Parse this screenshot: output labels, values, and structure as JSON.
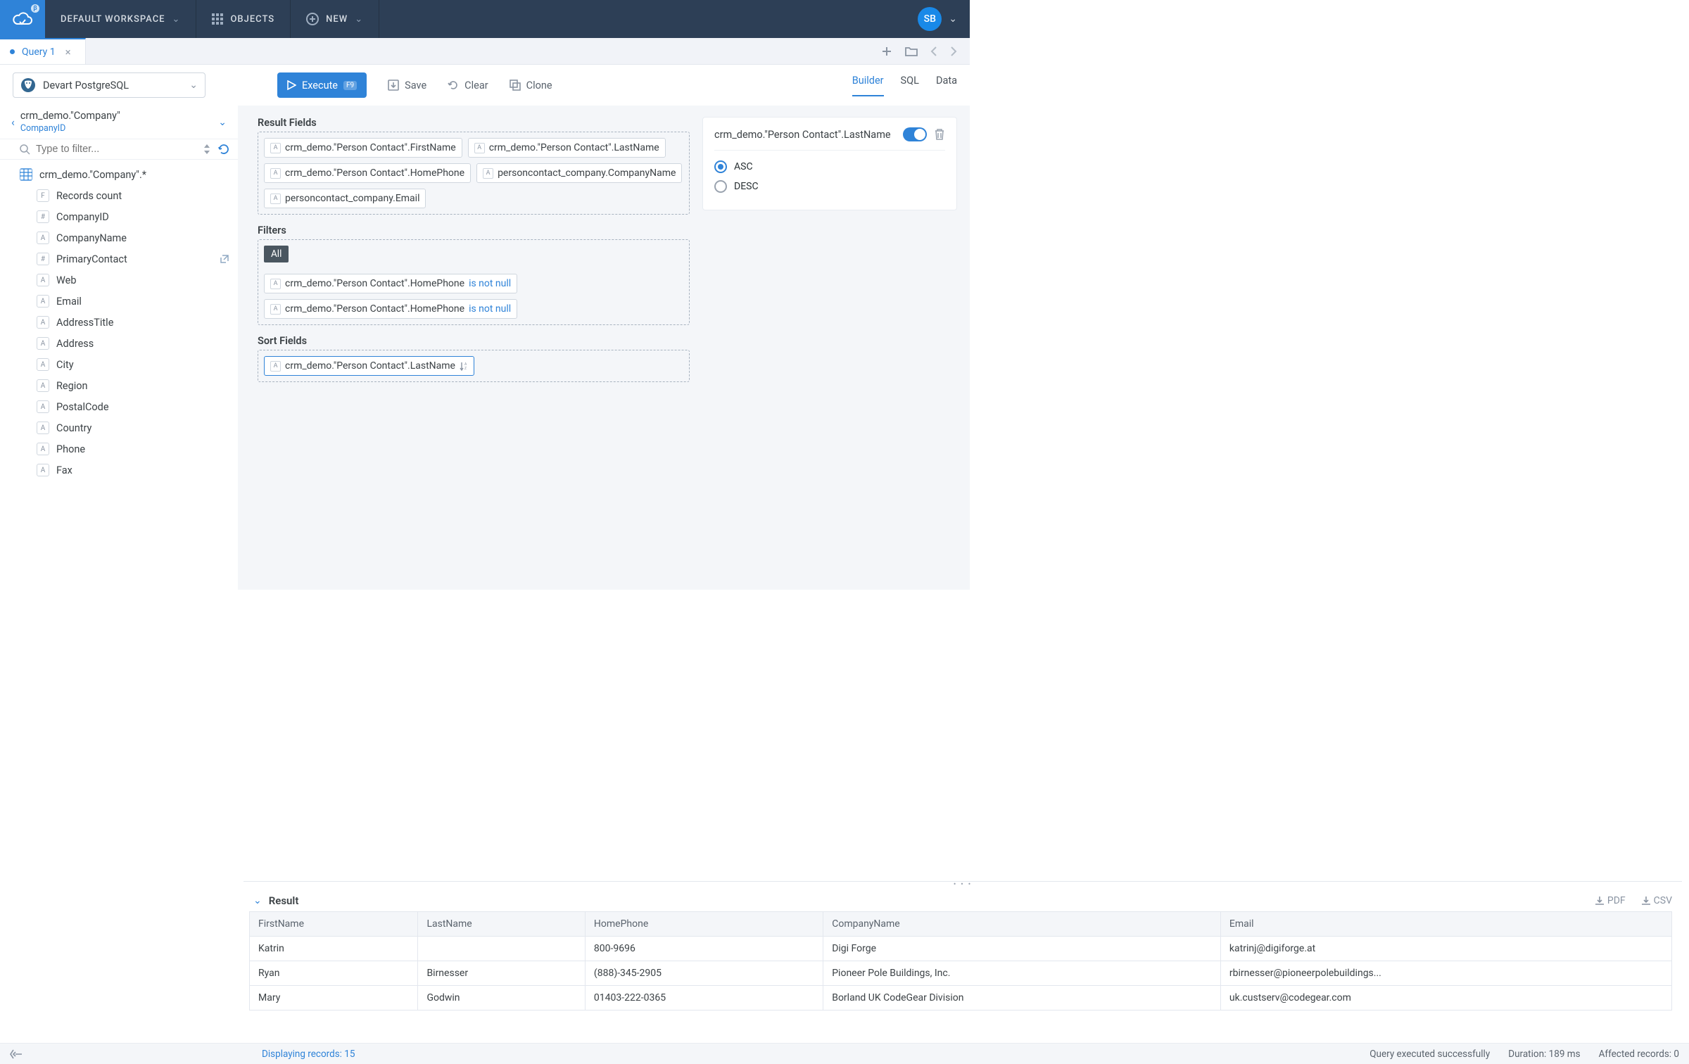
{
  "topbar": {
    "workspace": "DEFAULT WORKSPACE",
    "objects": "OBJECTS",
    "new": "NEW",
    "avatar": "SB"
  },
  "tabs": {
    "query": "Query 1"
  },
  "toolbar": {
    "connection": "Devart PostgreSQL",
    "execute": "Execute",
    "execute_key": "F9",
    "save": "Save",
    "clear": "Clear",
    "clone": "Clone"
  },
  "modes": {
    "builder": "Builder",
    "sql": "SQL",
    "data": "Data"
  },
  "breadcrumb": {
    "main": "crm_demo.\"Company\"",
    "sub": "CompanyID"
  },
  "filter": {
    "placeholder": "Type to filter..."
  },
  "tree": {
    "root": "crm_demo.\"Company\".*",
    "children": [
      {
        "icon": "F",
        "label": "Records count"
      },
      {
        "icon": "#",
        "label": "CompanyID"
      },
      {
        "icon": "A",
        "label": "CompanyName"
      },
      {
        "icon": "#",
        "label": "PrimaryContact",
        "ext": true
      },
      {
        "icon": "A",
        "label": "Web"
      },
      {
        "icon": "A",
        "label": "Email"
      },
      {
        "icon": "A",
        "label": "AddressTitle"
      },
      {
        "icon": "A",
        "label": "Address"
      },
      {
        "icon": "A",
        "label": "City"
      },
      {
        "icon": "A",
        "label": "Region"
      },
      {
        "icon": "A",
        "label": "PostalCode"
      },
      {
        "icon": "A",
        "label": "Country"
      },
      {
        "icon": "A",
        "label": "Phone"
      },
      {
        "icon": "A",
        "label": "Fax"
      }
    ]
  },
  "builder": {
    "result_fields_title": "Result Fields",
    "result_fields": [
      "crm_demo.\"Person Contact\".FirstName",
      "crm_demo.\"Person Contact\".LastName",
      "crm_demo.\"Person Contact\".HomePhone",
      "personcontact_company.CompanyName",
      "personcontact_company.Email"
    ],
    "filters_title": "Filters",
    "filter_all": "All",
    "filters": [
      {
        "field": "crm_demo.\"Person Contact\".HomePhone",
        "cond": "is not null"
      },
      {
        "field": "crm_demo.\"Person Contact\".HomePhone",
        "cond": "is not null"
      }
    ],
    "sort_title": "Sort Fields",
    "sort_fields": [
      "crm_demo.\"Person Contact\".LastName"
    ]
  },
  "right_panel": {
    "title": "crm_demo.\"Person Contact\".LastName",
    "asc": "ASC",
    "desc": "DESC"
  },
  "result": {
    "title": "Result",
    "pdf": "PDF",
    "csv": "CSV",
    "headers": [
      "FirstName",
      "LastName",
      "HomePhone",
      "CompanyName",
      "Email"
    ],
    "rows": [
      [
        "Katrin",
        "",
        "800-9696",
        "Digi Forge",
        "katrinj@digiforge.at"
      ],
      [
        "Ryan",
        "Birnesser",
        "(888)-345-2905",
        "Pioneer Pole Buildings, Inc.",
        "rbirnesser@pioneerpolebuildings..."
      ],
      [
        "Mary",
        "Godwin",
        "01403-222-0365",
        "Borland UK CodeGear Division",
        "uk.custserv@codegear.com"
      ]
    ]
  },
  "status": {
    "displaying": "Displaying records: 15",
    "executed": "Query executed successfully",
    "duration": "Duration: 189 ms",
    "affected": "Affected records: 0"
  }
}
